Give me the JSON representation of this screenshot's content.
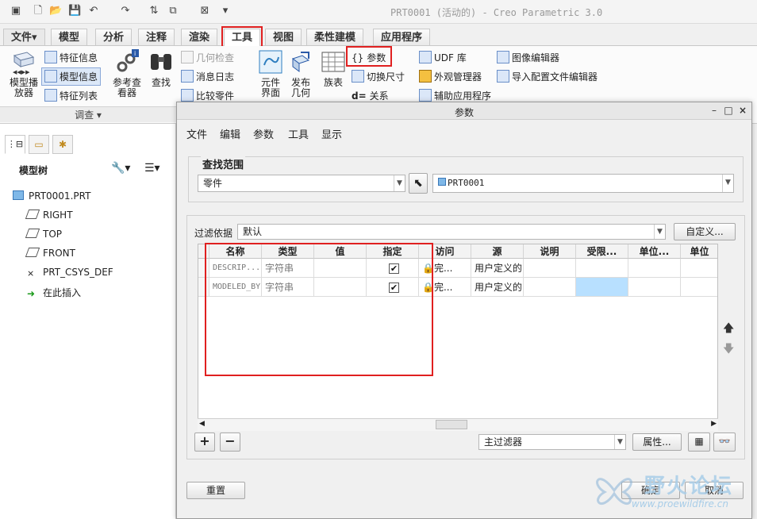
{
  "window": {
    "title": "PRT0001 (活动的) - Creo Parametric 3.0"
  },
  "ribbon": {
    "tabs": [
      {
        "label": "文件▾"
      },
      {
        "label": "模型"
      },
      {
        "label": "分析"
      },
      {
        "label": "注释"
      },
      {
        "label": "渲染"
      },
      {
        "label": "工具"
      },
      {
        "label": "视图"
      },
      {
        "label": "柔性建模"
      },
      {
        "label": "应用程序"
      }
    ],
    "active_tab": "工具",
    "buttons": {
      "model_player": "模型播\n放器",
      "feature_info": "特征信息",
      "model_info": "模型信息",
      "feature_list": "特征列表",
      "reference_viewer": "参考查\n看器",
      "find": "查找",
      "geometry_check": "几何检查",
      "message_log": "消息日志",
      "compare_part": "比较零件",
      "component_interface": "元件\n界面",
      "publish_geometry": "发布\n几何",
      "family_table": "族表",
      "parameters": "参数",
      "switch_dimensions": "切换尺寸",
      "relations": "关系",
      "udf_library": "UDF 库",
      "appearance_manager": "外观管理器",
      "auxiliary_app": "辅助应用程序",
      "image_editor": "图像编辑器",
      "import_config_editor": "导入配置文件编辑器"
    },
    "group_label": "调查 ▾"
  },
  "left_panel": {
    "tree_title": "模型树",
    "tree_items": [
      {
        "label": "PRT0001.PRT",
        "icon": "part-icon"
      },
      {
        "label": "RIGHT",
        "icon": "datum-plane-icon"
      },
      {
        "label": "TOP",
        "icon": "datum-plane-icon"
      },
      {
        "label": "FRONT",
        "icon": "datum-plane-icon"
      },
      {
        "label": "PRT_CSYS_DEF",
        "icon": "csys-icon"
      },
      {
        "label": "在此插入",
        "icon": "insert-arrow-icon"
      }
    ]
  },
  "dialog": {
    "title": "参数",
    "menu": [
      "文件",
      "编辑",
      "参数",
      "工具",
      "显示"
    ],
    "scope": {
      "legend": "查找范围",
      "type_value": "零件",
      "object_value": "PRT0001"
    },
    "filter": {
      "label": "过滤依据",
      "value": "默认",
      "customize_button": "自定义..."
    },
    "table": {
      "headers": [
        "名称",
        "类型",
        "值",
        "指定",
        "访问",
        "源",
        "说明",
        "受限...",
        "单位...",
        "单位"
      ],
      "rows": [
        [
          "DESCRIP...",
          "字符串",
          "",
          "✔",
          "完...",
          "用户定义的",
          "",
          "",
          "",
          ""
        ],
        [
          "MODELED_BY",
          "字符串",
          "",
          "✔",
          "完...",
          "用户定义的",
          "",
          "",
          "",
          ""
        ]
      ]
    },
    "bottom": {
      "main_filter": "主过滤器",
      "properties_button": "属性...",
      "reset_button": "重置",
      "ok_button": "确定",
      "cancel_button": "取消"
    }
  },
  "watermark": {
    "cn": "野火论坛",
    "url": "www.proewildfire.cn"
  },
  "colors": {
    "highlight_cell": "#b8e0ff",
    "red_outline": "#e02020",
    "window_title": "#9a9a9a"
  }
}
